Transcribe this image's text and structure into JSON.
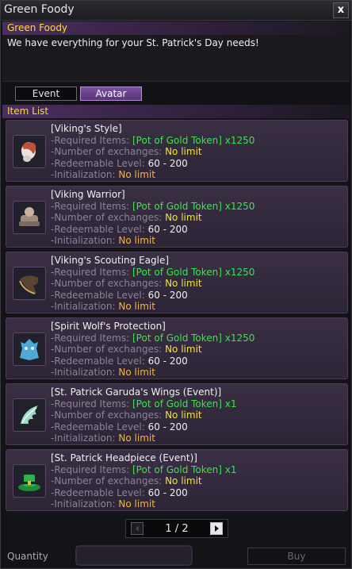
{
  "window": {
    "title": "Green Foody",
    "close_label": "x"
  },
  "npc": {
    "name": "Green Foody",
    "greeting": "We have everything for your St. Patrick's Day needs!"
  },
  "tabs": [
    {
      "label": "Event"
    },
    {
      "label": "Avatar"
    }
  ],
  "section": {
    "title": "Item List"
  },
  "items": [
    {
      "name": "[Viking's Style]",
      "req_label": "-Required Items:",
      "req_value": "[Pot of Gold Token] x1250",
      "ex_label": "-Number of exchanges:",
      "ex_value": "No limit",
      "lvl_label": "-Redeemable Level:",
      "lvl_value": "60 - 200",
      "init_label": "-Initialization:",
      "init_value": "No limit",
      "icon": "viking-style-icon"
    },
    {
      "name": "[Viking Warrior]",
      "req_label": "-Required Items:",
      "req_value": "[Pot of Gold Token] x1250",
      "ex_label": "-Number of exchanges:",
      "ex_value": "No limit",
      "lvl_label": "-Redeemable Level:",
      "lvl_value": "60 - 200",
      "init_label": "-Initialization:",
      "init_value": "No limit",
      "icon": "viking-warrior-icon"
    },
    {
      "name": "[Viking's Scouting Eagle]",
      "req_label": "-Required Items:",
      "req_value": "[Pot of Gold Token] x1250",
      "ex_label": "-Number of exchanges:",
      "ex_value": "No limit",
      "lvl_label": "-Redeemable Level:",
      "lvl_value": "60 - 200",
      "init_label": "-Initialization:",
      "init_value": "No limit",
      "icon": "eagle-icon"
    },
    {
      "name": "[Spirit Wolf's Protection]",
      "req_label": "-Required Items:",
      "req_value": "[Pot of Gold Token] x1250",
      "ex_label": "-Number of exchanges:",
      "ex_value": "No limit",
      "lvl_label": "-Redeemable Level:",
      "lvl_value": "60 - 200",
      "init_label": "-Initialization:",
      "init_value": "No limit",
      "icon": "spirit-wolf-icon"
    },
    {
      "name": "[St. Patrick Garuda's Wings (Event)]",
      "req_label": "-Required Items:",
      "req_value": "[Pot of Gold Token] x1",
      "ex_label": "-Number of exchanges:",
      "ex_value": "No limit",
      "lvl_label": "-Redeemable Level:",
      "lvl_value": "60 - 200",
      "init_label": "-Initialization:",
      "init_value": "No limit",
      "icon": "garuda-wings-icon"
    },
    {
      "name": "[St. Patrick Headpiece (Event)]",
      "req_label": "-Required Items:",
      "req_value": "[Pot of Gold Token] x1",
      "ex_label": "-Number of exchanges:",
      "ex_value": "No limit",
      "lvl_label": "-Redeemable Level:",
      "lvl_value": "60 - 200",
      "init_label": "-Initialization:",
      "init_value": "No limit",
      "icon": "green-hat-icon"
    }
  ],
  "pager": {
    "text": "1 / 2"
  },
  "quantity": {
    "label": "Quantity",
    "value": ""
  },
  "buy": {
    "label": "Buy"
  }
}
